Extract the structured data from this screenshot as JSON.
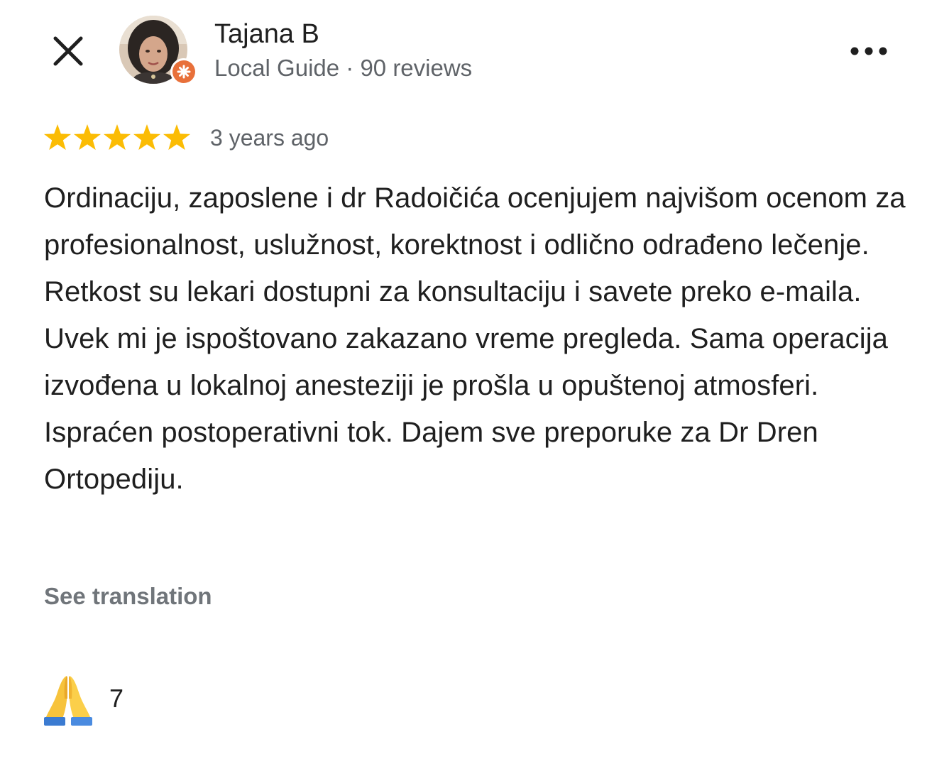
{
  "header": {
    "close_icon": "close-icon",
    "more_icon": "more-horizontal-icon"
  },
  "reviewer": {
    "name": "Tajana B",
    "meta": "Local Guide · 90 reviews",
    "badge_icon": "local-guide-star-icon",
    "badge_color": "#e8703a"
  },
  "review": {
    "rating": 5,
    "rating_max": 5,
    "star_color": "#fbbc04",
    "time_ago": "3 years ago",
    "text": "Ordinaciju, zaposlene i dr Radoičića ocenjujem najvišom ocenom za profesionalnost, uslužnost, korektnost i odlično odrađeno lečenje. Retkost su lekari dostupni za konsultaciju i savete preko e-maila. Uvek mi je ispoštovano zakazano vreme pregleda. Sama operacija izvođena u lokalnoj anesteziji je prošla u opuštenoj atmosferi. Ispraćen postoperativni tok. Dajem sve preporuke za Dr Dren Ortopediju.",
    "see_translation": "See translation"
  },
  "reactions": {
    "emoji_icon": "folded-hands-icon",
    "count": "7"
  }
}
